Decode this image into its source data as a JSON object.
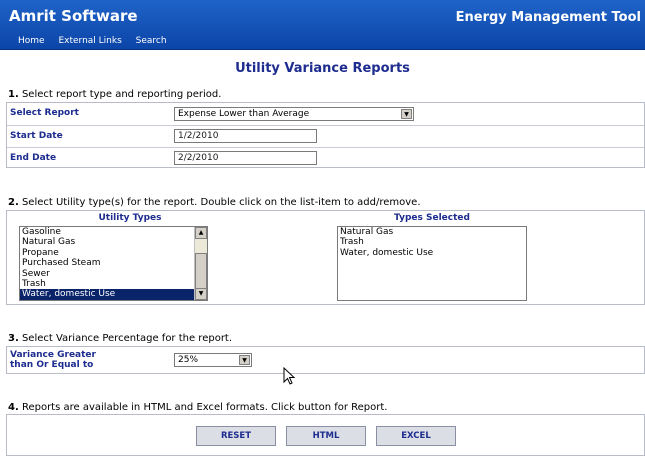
{
  "header": {
    "brand": "Amrit Software",
    "app_title": "Energy Management Tool",
    "nav": [
      "Home",
      "External Links",
      "Search"
    ]
  },
  "page_title": "Utility Variance Reports",
  "step1": {
    "num": "1.",
    "text": "Select report type and reporting period.",
    "select_report_label": "Select Report",
    "select_report_value": "Expense Lower than Average",
    "start_date_label": "Start Date",
    "start_date_value": "1/2/2010",
    "end_date_label": "End Date",
    "end_date_value": "2/2/2010"
  },
  "step2": {
    "num": "2.",
    "text": "Select Utility type(s) for the report.  Double click on the list-item to add/remove.",
    "utility_types_header": "Utility Types",
    "types_selected_header": "Types Selected",
    "utility_types": [
      "Gasoline",
      "Natural Gas",
      "Propane",
      "Purchased Steam",
      "Sewer",
      "Trash",
      "Water, domestic Use"
    ],
    "highlighted_item": "Water, domestic Use",
    "types_selected": [
      "Natural Gas",
      "Trash",
      "Water, domestic Use"
    ]
  },
  "step3": {
    "num": "3.",
    "text": "Select Variance Percentage for the report.",
    "variance_label_line1": "Variance Greater",
    "variance_label_line2": "than Or Equal to",
    "variance_value": "25%"
  },
  "step4": {
    "num": "4.",
    "text": "Reports are available in HTML and Excel formats. Click button for Report.",
    "buttons": [
      "RESET",
      "HTML",
      "EXCEL"
    ]
  },
  "colors": {
    "header_bg": "#0c45a8",
    "label_blue": "#1d2c8f",
    "selection": "#0a246a"
  }
}
